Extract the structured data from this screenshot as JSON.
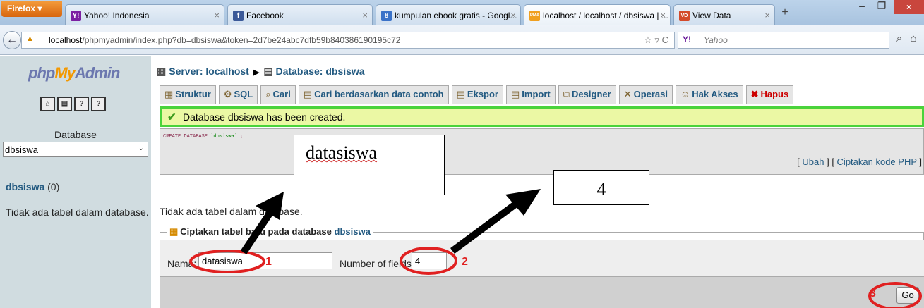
{
  "browser": {
    "menu_button": "Firefox",
    "tabs": [
      {
        "title": "Yahoo! Indonesia",
        "favicon": "Y!",
        "active": false
      },
      {
        "title": "Facebook",
        "favicon": "f",
        "active": false
      },
      {
        "title": "kumpulan ebook gratis - Googl...",
        "favicon": "8",
        "active": false
      },
      {
        "title": "localhost / localhost / dbsiswa | ...",
        "favicon": "PMA",
        "active": true
      },
      {
        "title": "View Data",
        "favicon": "VD",
        "active": false
      }
    ],
    "url_host": "localhost",
    "url_path": "/phpmyadmin/index.php?db=dbsiswa&token=2d7be24abc7dfb59b840386190195c72",
    "search_engine": "Y!",
    "search_placeholder": "Yahoo"
  },
  "sidebar": {
    "logo_php": "php",
    "logo_my": "My",
    "logo_admin": "Admin",
    "database_label": "Database",
    "database_select": "dbsiswa",
    "db_link_name": "dbsiswa",
    "db_link_count": "(0)",
    "no_tables_text": "Tidak ada tabel dalam database."
  },
  "main": {
    "breadcrumb": {
      "server": "Server: localhost",
      "database": "Database: dbsiswa"
    },
    "tabs": [
      "Struktur",
      "SQL",
      "Cari",
      "Cari berdasarkan data contoh",
      "Ekspor",
      "Import",
      "Designer",
      "Operasi",
      "Hak Akses",
      "Hapus"
    ],
    "success_message": "Database dbsiswa has been created.",
    "sql_keyword": "CREATE DATABASE",
    "sql_string": "`dbsiswa`",
    "sql_end": ";",
    "link_edit": "Ubah",
    "link_php": "Ciptakan kode PHP",
    "no_tables_text": "Tidak ada tabel dalam database.",
    "create_table_legend": "Ciptakan tabel baru pada database",
    "create_table_db": "dbsiswa",
    "name_label": "Nama:",
    "name_value": "datasiswa",
    "fields_label": "Number of fields:",
    "fields_value": "4",
    "go_button": "Go"
  },
  "annotations": {
    "callout_name": "datasiswa",
    "callout_fields": "4",
    "marker_1": "1",
    "marker_2": "2",
    "marker_3": "3",
    "color": "#e02020"
  }
}
